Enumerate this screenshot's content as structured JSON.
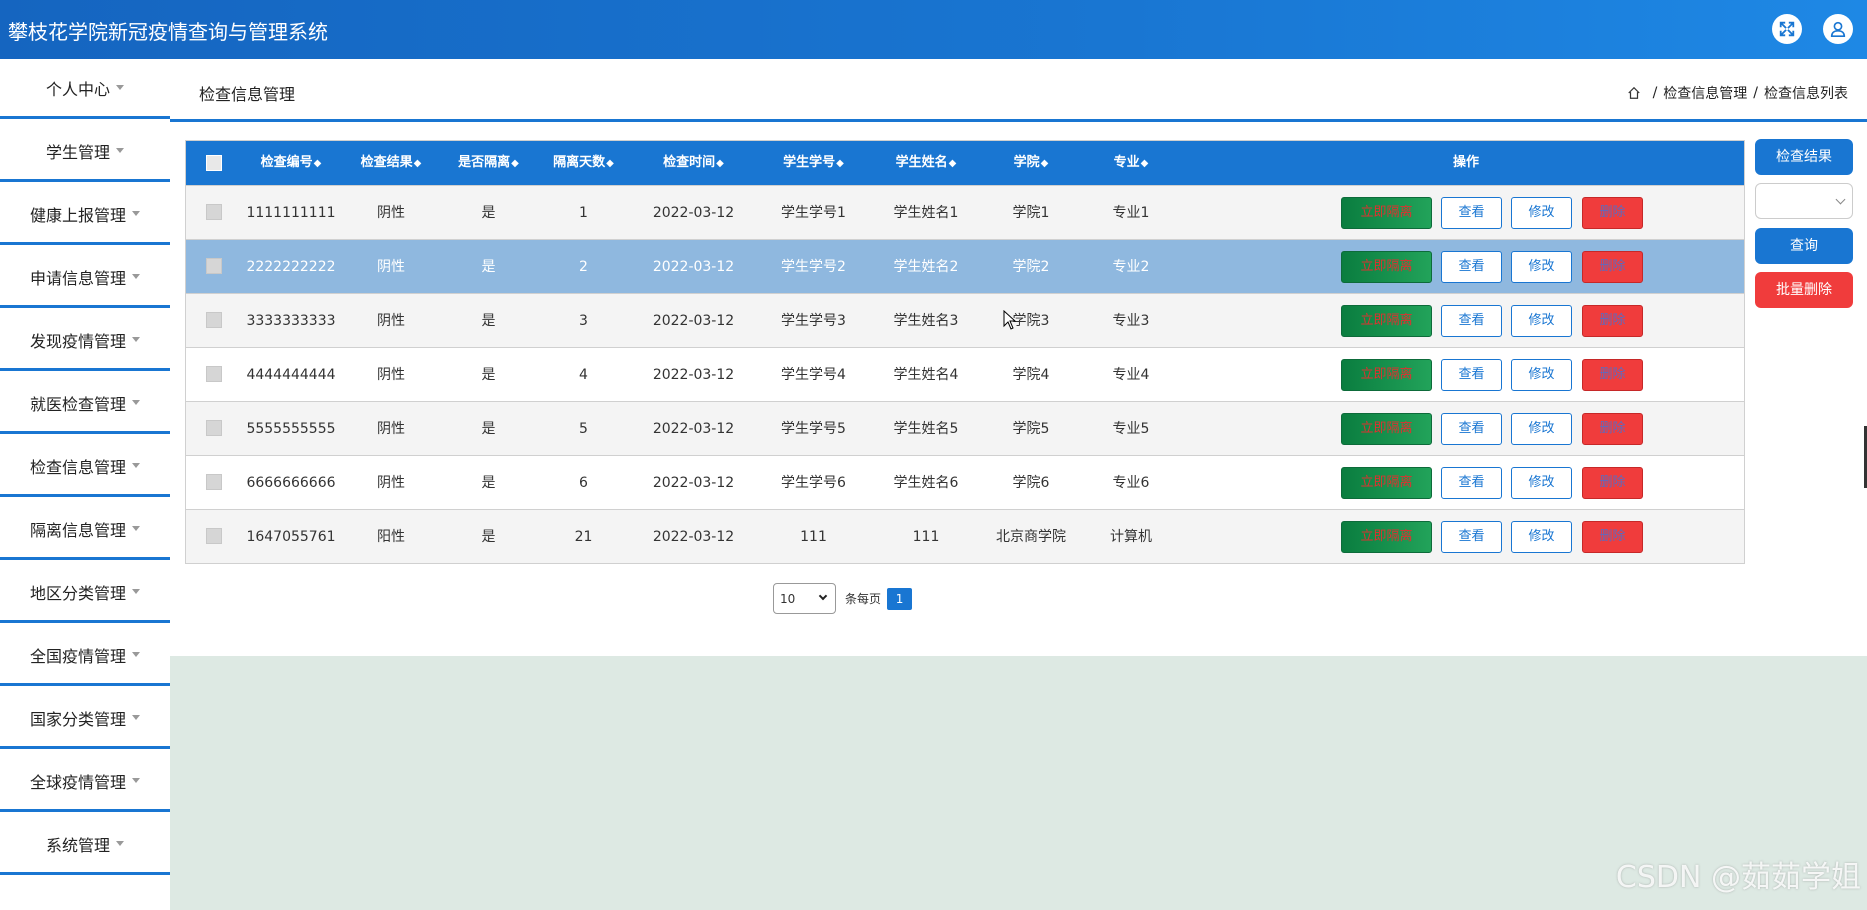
{
  "app": {
    "title": "攀枝花学院新冠疫情查询与管理系统"
  },
  "topbar": {
    "fullscreen_icon": "fullscreen-icon",
    "user_icon": "user-icon"
  },
  "sidebar": {
    "items": [
      {
        "label": "个人中心"
      },
      {
        "label": "学生管理"
      },
      {
        "label": "健康上报管理"
      },
      {
        "label": "申请信息管理"
      },
      {
        "label": "发现疫情管理"
      },
      {
        "label": "就医检查管理"
      },
      {
        "label": "检查信息管理"
      },
      {
        "label": "隔离信息管理"
      },
      {
        "label": "地区分类管理"
      },
      {
        "label": "全国疫情管理"
      },
      {
        "label": "国家分类管理"
      },
      {
        "label": "全球疫情管理"
      },
      {
        "label": "系统管理"
      }
    ]
  },
  "header": {
    "title": "检查信息管理",
    "breadcrumb": {
      "home_icon": "home-icon",
      "level1": "检查信息管理",
      "sep": "/",
      "level2": "检查信息列表"
    }
  },
  "table": {
    "sort_glyph": "◆",
    "columns": [
      "检查编号",
      "检查结果",
      "是否隔离",
      "隔离天数",
      "检查时间",
      "学生学号",
      "学生姓名",
      "学院",
      "专业",
      "操作"
    ],
    "actions": {
      "isolate": "立即隔离",
      "view": "查看",
      "edit": "修改",
      "delete": "删除"
    },
    "rows": [
      {
        "id": "1111111111",
        "result": "阴性",
        "isolated": "是",
        "days": "1",
        "time": "2022-03-12",
        "student_no": "学生学号1",
        "student_name": "学生姓名1",
        "college": "学院1",
        "major": "专业1"
      },
      {
        "id": "2222222222",
        "result": "阴性",
        "isolated": "是",
        "days": "2",
        "time": "2022-03-12",
        "student_no": "学生学号2",
        "student_name": "学生姓名2",
        "college": "学院2",
        "major": "专业2"
      },
      {
        "id": "3333333333",
        "result": "阴性",
        "isolated": "是",
        "days": "3",
        "time": "2022-03-12",
        "student_no": "学生学号3",
        "student_name": "学生姓名3",
        "college": "学院3",
        "major": "专业3"
      },
      {
        "id": "4444444444",
        "result": "阴性",
        "isolated": "是",
        "days": "4",
        "time": "2022-03-12",
        "student_no": "学生学号4",
        "student_name": "学生姓名4",
        "college": "学院4",
        "major": "专业4"
      },
      {
        "id": "5555555555",
        "result": "阴性",
        "isolated": "是",
        "days": "5",
        "time": "2022-03-12",
        "student_no": "学生学号5",
        "student_name": "学生姓名5",
        "college": "学院5",
        "major": "专业5"
      },
      {
        "id": "6666666666",
        "result": "阴性",
        "isolated": "是",
        "days": "6",
        "time": "2022-03-12",
        "student_no": "学生学号6",
        "student_name": "学生姓名6",
        "college": "学院6",
        "major": "专业6"
      },
      {
        "id": "1647055761",
        "result": "阳性",
        "isolated": "是",
        "days": "21",
        "time": "2022-03-12",
        "student_no": "111",
        "student_name": "111",
        "college": "北京商学院",
        "major": "计算机"
      }
    ]
  },
  "search_panel": {
    "result_label": "检查结果",
    "result_value": "",
    "query_button": "查询",
    "batch_delete_button": "批量删除"
  },
  "pagination": {
    "page_size": "10",
    "per_page_label": "条每页",
    "current_page": "1"
  },
  "watermark": "CSDN @茹茹学姐",
  "colors": {
    "primary": "#1976d2",
    "danger": "#f03c3c",
    "success": "#0a7d3f",
    "selected_row": "#8fb8df"
  }
}
